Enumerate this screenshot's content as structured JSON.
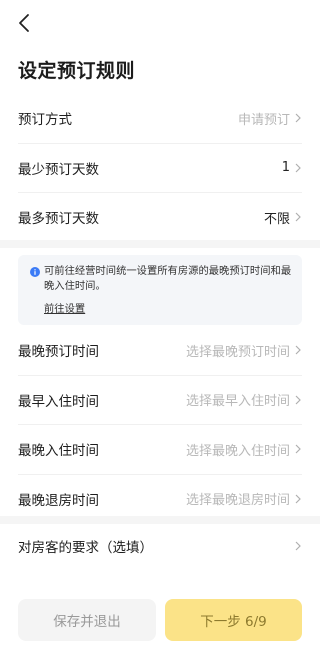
{
  "page": {
    "title": "设定预订规则"
  },
  "booking_rows": [
    {
      "label": "预订方式",
      "value": "申请预订",
      "placeholder": true
    },
    {
      "label": "最少预订天数",
      "value": "1",
      "placeholder": false
    },
    {
      "label": "最多预订天数",
      "value": "不限",
      "placeholder": false
    }
  ],
  "notice": {
    "text": "可前往经营时间统一设置所有房源的最晚预订时间和最晚入住时间。",
    "link": "前往设置"
  },
  "time_rows": [
    {
      "label": "最晚预订时间",
      "value": "选择最晚预订时间"
    },
    {
      "label": "最早入住时间",
      "value": "选择最早入住时间"
    },
    {
      "label": "最晚入住时间",
      "value": "选择最晚入住时间"
    },
    {
      "label": "最晚退房时间",
      "value": "选择最晚退房时间"
    }
  ],
  "guest_requirement": {
    "label": "对房客的要求（选填）"
  },
  "footer": {
    "save_exit": "保存并退出",
    "next_step": "下一步 6/9"
  },
  "colors": {
    "primary_button": "#fbe388",
    "primary_text": "#8d7a2e",
    "notice_bg": "#f4f6f9",
    "info_icon": "#3b7bf6"
  }
}
